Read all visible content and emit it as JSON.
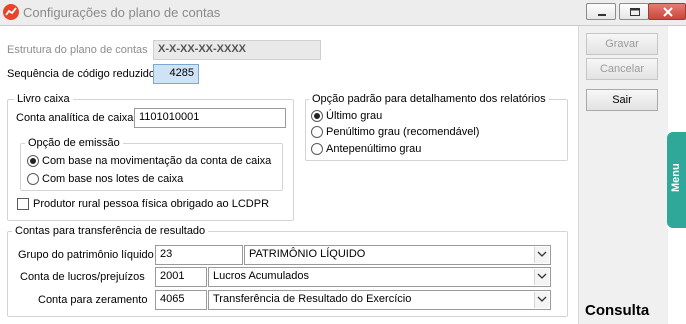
{
  "window": {
    "title": "Configurações do plano de contas",
    "icon": "app-logo-icon",
    "controls": [
      "minimize-icon",
      "maximize-icon",
      "close-icon"
    ]
  },
  "estrutura": {
    "label": "Estrutura do plano de contas",
    "value": "X-X-XX-XX-XXXX"
  },
  "sequencia": {
    "label": "Sequência de código reduzido",
    "value": "4285"
  },
  "livro_caixa": {
    "title": "Livro caixa",
    "conta_label": "Conta analítica de caixa",
    "conta_value": "1101010001",
    "opcao_emissao": {
      "title": "Opção de emissão",
      "options": [
        {
          "label": "Com base na movimentação da conta de caixa",
          "selected": true
        },
        {
          "label": "Com base nos lotes de caixa",
          "selected": false
        }
      ]
    },
    "produtor_rural": {
      "label": "Produtor rural pessoa física obrigado ao LCDPR",
      "checked": false
    }
  },
  "opcao_padrao": {
    "title": "Opção padrão para detalhamento dos relatórios",
    "options": [
      {
        "label": "Último grau",
        "selected": true
      },
      {
        "label": "Penúltimo grau (recomendável)",
        "selected": false
      },
      {
        "label": "Antepenúltimo grau",
        "selected": false
      }
    ]
  },
  "transferencia": {
    "title": "Contas para transferência de resultado",
    "rows": [
      {
        "label": "Grupo do patrimônio líquido",
        "code": "23",
        "desc": "PATRIMÔNIO LÍQUIDO"
      },
      {
        "label": "Conta de lucros/prejuízos",
        "code": "2001",
        "desc": "Lucros Acumulados"
      },
      {
        "label": "Conta para zeramento",
        "code": "4065",
        "desc": "Transferência de Resultado do Exercício"
      }
    ]
  },
  "buttons": {
    "gravar": "Gravar",
    "cancelar": "Cancelar",
    "sair": "Sair"
  },
  "consulta": "Consulta",
  "menu_tab": "Menu",
  "colors": {
    "accent": "#2fa89a",
    "highlight": "#cfe3f7",
    "app_icon": "#e8442a"
  }
}
